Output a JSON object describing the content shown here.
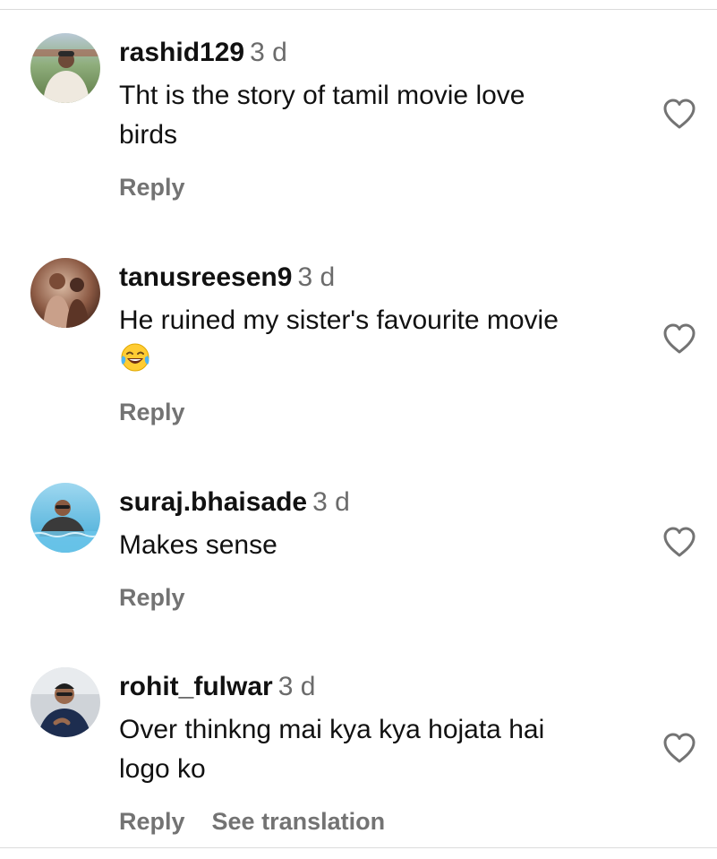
{
  "comments": [
    {
      "username": "rashid129",
      "time": "3 d",
      "line1": "Tht is the story of tamil movie love",
      "line2": "birds",
      "reply": "Reply"
    },
    {
      "username": "tanusreesen9",
      "time": "3 d",
      "line1": "He ruined my sister's favourite movie",
      "emoji": "face-with-tears-of-joy-emoji",
      "reply": "Reply"
    },
    {
      "username": "suraj.bhaisade",
      "time": "3 d",
      "line1": "Makes sense",
      "reply": "Reply"
    },
    {
      "username": "rohit_fulwar",
      "time": "3 d",
      "line1": "Over thinkng mai kya kya hojata hai",
      "line2": "logo ko",
      "reply": "Reply",
      "see_translation": "See translation"
    }
  ],
  "icons": {
    "like": "heart-outline-icon"
  },
  "colors": {
    "text": "#111111",
    "muted": "#737373",
    "divider": "#dbdbdb"
  }
}
